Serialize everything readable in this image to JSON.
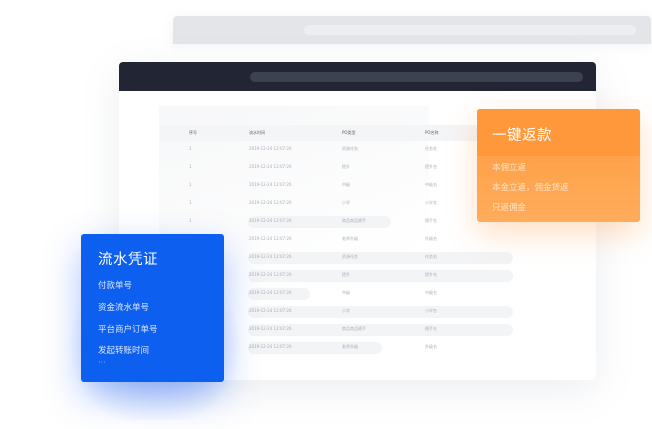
{
  "table": {
    "headers": [
      "序号",
      "流水时间",
      "PO类型",
      "PO名称"
    ],
    "rows": [
      {
        "no": "1",
        "time": "2019-12-24 12:07:26",
        "type": "资源任务",
        "name": "任务名"
      },
      {
        "no": "1",
        "time": "2019-12-24 12:07:26",
        "type": "提升",
        "name": "提升名"
      },
      {
        "no": "1",
        "time": "2019-12-24 12:07:26",
        "type": "中级",
        "name": "中级名"
      },
      {
        "no": "1",
        "time": "2019-12-24 12:07:26",
        "type": "小学",
        "name": "小学名"
      },
      {
        "no": "1",
        "time": "2019-12-24 12:07:26",
        "type": "商品商品随手",
        "name": "随手名"
      },
      {
        "no": "",
        "time": "2019-12-24 12:07:26",
        "type": "老师升级",
        "name": "升级名"
      },
      {
        "no": "",
        "time": "2019-12-24 12:07:26",
        "type": "资源任务",
        "name": "任务名"
      },
      {
        "no": "",
        "time": "2019-12-24 12:07:26",
        "type": "提升",
        "name": "提升名"
      },
      {
        "no": "",
        "time": "2019-12-24 12:07:26",
        "type": "中级",
        "name": "中级名"
      },
      {
        "no": "",
        "time": "2019-12-24 12:07:26",
        "type": "小学",
        "name": "小学名"
      },
      {
        "no": "",
        "time": "2019-12-24 12:07:26",
        "type": "商品商品随手",
        "name": "随手名"
      },
      {
        "no": "",
        "time": "2019-12-24 12:07:26",
        "type": "老师升级",
        "name": "升级名"
      }
    ]
  },
  "refund_card": {
    "title": "一键返款",
    "items": [
      "本佣立返",
      "本金立返，佣金货返",
      "只返佣金"
    ],
    "color": "#ff983a"
  },
  "flow_card": {
    "title": "流水凭证",
    "items": [
      "付款单号",
      "资金流水单号",
      "平台商户订单号",
      "发起转账时间"
    ],
    "more": "···",
    "color": "#0d5ff0"
  },
  "colors": {
    "titlebar": "#222634",
    "accent_blue": "#0d5ff0",
    "accent_orange": "#ff983a"
  }
}
